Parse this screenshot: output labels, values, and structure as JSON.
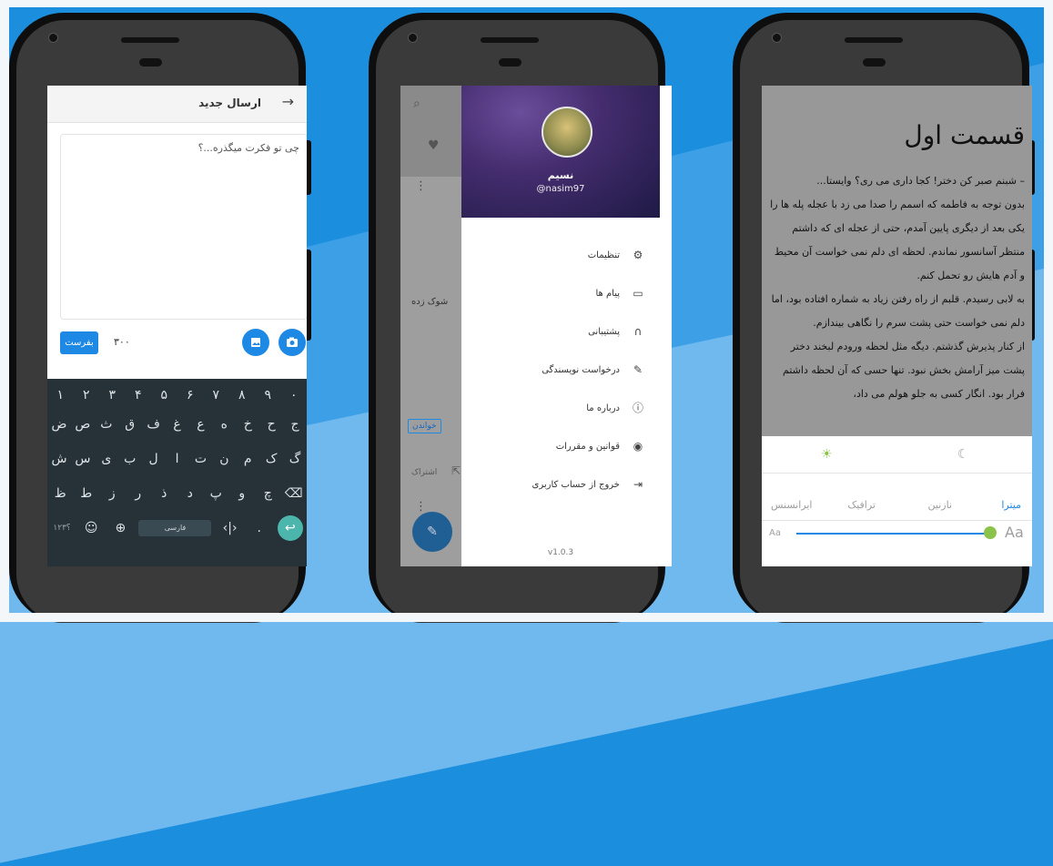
{
  "composer": {
    "title": "ارسال جدید",
    "placeholder": "چی تو فکرت میگذره...؟",
    "send_label": "بفرست",
    "char_count": "۳۰۰"
  },
  "keyboard": {
    "row1": [
      "۱",
      "۲",
      "۳",
      "۴",
      "۵",
      "۶",
      "۷",
      "۸",
      "۹",
      "۰"
    ],
    "row2": [
      "ج",
      "ح",
      "خ",
      "ه",
      "ع",
      "غ",
      "ف",
      "ق",
      "ث",
      "ص",
      "ض"
    ],
    "row3": [
      "گ",
      "ک",
      "م",
      "ن",
      "ت",
      "ا",
      "ل",
      "ب",
      "ی",
      "س",
      "ش"
    ],
    "row4": [
      "ظ",
      "ط",
      "ز",
      "ر",
      "ذ",
      "د",
      "پ",
      "و",
      "چ"
    ],
    "numbers_key": "؟۱۲۳",
    "lang_label": "فارسی"
  },
  "drawer": {
    "name": "نسیم",
    "username": "@nasim97",
    "items": [
      {
        "label": "تنظیمات",
        "icon": "gear-icon"
      },
      {
        "label": "پیام ها",
        "icon": "inbox-icon"
      },
      {
        "label": "پشتیبانی",
        "icon": "headset-icon"
      },
      {
        "label": "درخواست نویسندگی",
        "icon": "person-edit-icon"
      },
      {
        "label": "درباره ما",
        "icon": "info-icon"
      },
      {
        "label": "قوانین و مقررات",
        "icon": "radio-icon"
      },
      {
        "label": "خروج از حساب کاربری",
        "icon": "exit-icon"
      }
    ],
    "version": "v1.0.3",
    "behind": {
      "story_text": "شوک زده",
      "read_button": "خواندن",
      "share_label": "اشتراک"
    }
  },
  "reader": {
    "title": "قسمت اول",
    "paragraphs": [
      "– شبنم صبر کن دختر! کجا داری می ری؟ وایستا...",
      "بدون توجه به فاطمه که اسمم را صدا می زد با عجله پله ها را یکی بعد از دیگری پایین آمدم، حتی از عجله ای که داشتم منتظر آسانسور نماندم. لحظه ای دلم نمی خواست آن محیط و آدم هایش رو تحمل کنم.",
      "به لابی رسیدم. قلبم از راه رفتن زیاد به شماره افتاده بود، اما دلم نمی خواست حتی پشت سرم را نگاهی بیندازم.",
      "از کنار پذیرش گذشتم. دیگه مثل لحظه ورودم لبخند دختر پشت میز آرامش بخش نبود. تنها حسی که آن لحظه داشتم فرار بود. انگار کسی به جلو هولم می داد،"
    ],
    "fonts": [
      "میترا",
      "نازنین",
      "ترافیک",
      "ایرانسنس"
    ],
    "selected_font": "میترا",
    "font_size_small": "Aa",
    "font_size_large": "Aa",
    "font_size_level": 0.97,
    "colors": {
      "accent": "#1e88e5",
      "knob": "#8bc34a"
    }
  }
}
